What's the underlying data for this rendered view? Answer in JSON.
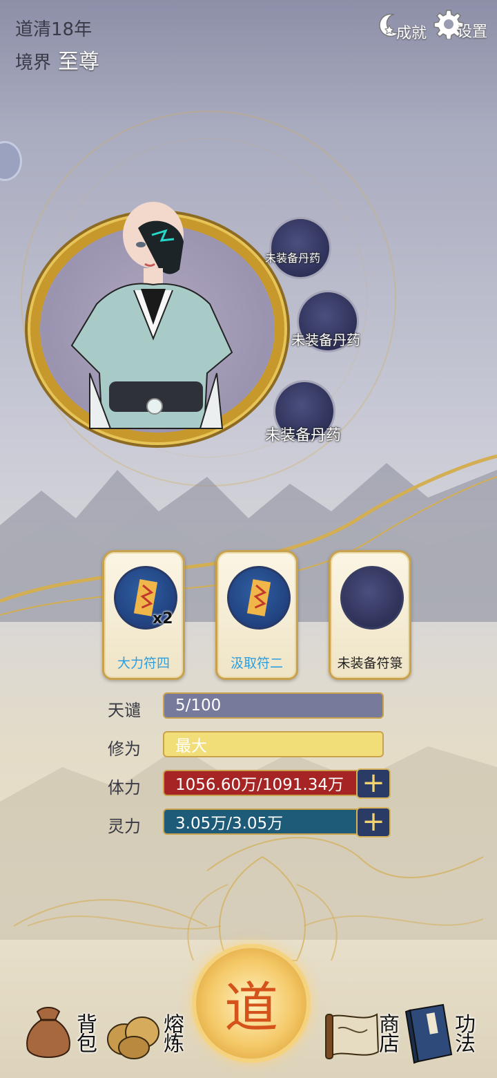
{
  "header": {
    "year_text": "道清18年",
    "realm_label": "境界",
    "realm_value": "至尊",
    "achievements_label": "成就",
    "settings_label": "设置"
  },
  "pill_slots": [
    {
      "label": "未装备丹药"
    },
    {
      "label": "未装备丹药"
    },
    {
      "label": "未装备丹药"
    }
  ],
  "talismans": [
    {
      "label": "大力符四",
      "count": "x2",
      "label_color": "#2f9ee0"
    },
    {
      "label": "汲取符二",
      "count": "",
      "label_color": "#2f9ee0"
    },
    {
      "label": "未装备符箓",
      "count": "",
      "label_color": "#222222"
    }
  ],
  "stats": [
    {
      "label": "天谴",
      "value": "5/100",
      "fraction": 0.05,
      "color": "#787a9c"
    },
    {
      "label": "修为",
      "value": "最大",
      "fraction": 1.0,
      "color": "#f2de78"
    },
    {
      "label": "体力",
      "value": "1056.60万/1091.34万",
      "fraction": 0.968,
      "color": "#a62424"
    },
    {
      "label": "灵力",
      "value": "3.05万/3.05万",
      "fraction": 1.0,
      "color": "#1d5b78"
    }
  ],
  "plus_symbol": "+",
  "nav": {
    "bag": "背包",
    "smelt": "熔炼",
    "center": "道",
    "shop": "商店",
    "skills": "功法"
  },
  "icons": {
    "achievements": "moon-star-icon",
    "settings": "gear-icon",
    "bag": "pouch-icon",
    "smelt": "cauldron-icon",
    "shop": "scroll-map-icon",
    "skills": "book-icon"
  }
}
